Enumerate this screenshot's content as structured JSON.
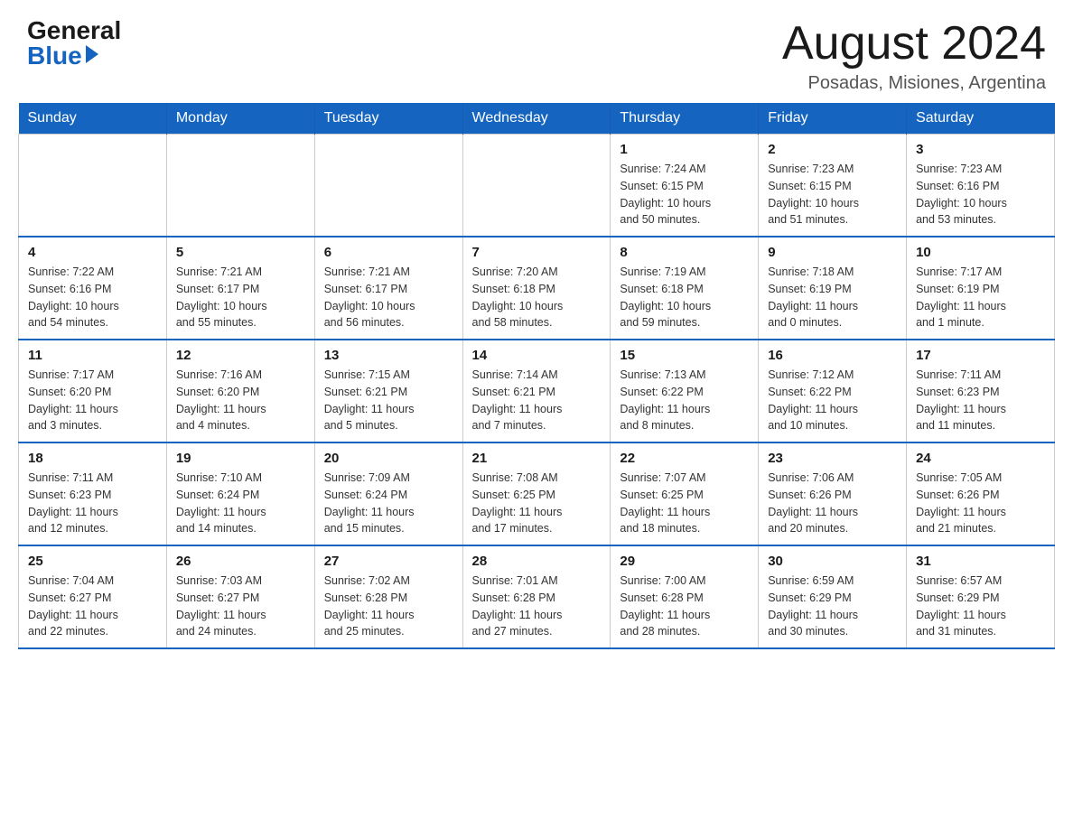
{
  "header": {
    "logo_general": "General",
    "logo_blue": "Blue",
    "month_title": "August 2024",
    "location": "Posadas, Misiones, Argentina"
  },
  "days_of_week": [
    "Sunday",
    "Monday",
    "Tuesday",
    "Wednesday",
    "Thursday",
    "Friday",
    "Saturday"
  ],
  "weeks": [
    [
      {
        "day": "",
        "info": ""
      },
      {
        "day": "",
        "info": ""
      },
      {
        "day": "",
        "info": ""
      },
      {
        "day": "",
        "info": ""
      },
      {
        "day": "1",
        "info": "Sunrise: 7:24 AM\nSunset: 6:15 PM\nDaylight: 10 hours\nand 50 minutes."
      },
      {
        "day": "2",
        "info": "Sunrise: 7:23 AM\nSunset: 6:15 PM\nDaylight: 10 hours\nand 51 minutes."
      },
      {
        "day": "3",
        "info": "Sunrise: 7:23 AM\nSunset: 6:16 PM\nDaylight: 10 hours\nand 53 minutes."
      }
    ],
    [
      {
        "day": "4",
        "info": "Sunrise: 7:22 AM\nSunset: 6:16 PM\nDaylight: 10 hours\nand 54 minutes."
      },
      {
        "day": "5",
        "info": "Sunrise: 7:21 AM\nSunset: 6:17 PM\nDaylight: 10 hours\nand 55 minutes."
      },
      {
        "day": "6",
        "info": "Sunrise: 7:21 AM\nSunset: 6:17 PM\nDaylight: 10 hours\nand 56 minutes."
      },
      {
        "day": "7",
        "info": "Sunrise: 7:20 AM\nSunset: 6:18 PM\nDaylight: 10 hours\nand 58 minutes."
      },
      {
        "day": "8",
        "info": "Sunrise: 7:19 AM\nSunset: 6:18 PM\nDaylight: 10 hours\nand 59 minutes."
      },
      {
        "day": "9",
        "info": "Sunrise: 7:18 AM\nSunset: 6:19 PM\nDaylight: 11 hours\nand 0 minutes."
      },
      {
        "day": "10",
        "info": "Sunrise: 7:17 AM\nSunset: 6:19 PM\nDaylight: 11 hours\nand 1 minute."
      }
    ],
    [
      {
        "day": "11",
        "info": "Sunrise: 7:17 AM\nSunset: 6:20 PM\nDaylight: 11 hours\nand 3 minutes."
      },
      {
        "day": "12",
        "info": "Sunrise: 7:16 AM\nSunset: 6:20 PM\nDaylight: 11 hours\nand 4 minutes."
      },
      {
        "day": "13",
        "info": "Sunrise: 7:15 AM\nSunset: 6:21 PM\nDaylight: 11 hours\nand 5 minutes."
      },
      {
        "day": "14",
        "info": "Sunrise: 7:14 AM\nSunset: 6:21 PM\nDaylight: 11 hours\nand 7 minutes."
      },
      {
        "day": "15",
        "info": "Sunrise: 7:13 AM\nSunset: 6:22 PM\nDaylight: 11 hours\nand 8 minutes."
      },
      {
        "day": "16",
        "info": "Sunrise: 7:12 AM\nSunset: 6:22 PM\nDaylight: 11 hours\nand 10 minutes."
      },
      {
        "day": "17",
        "info": "Sunrise: 7:11 AM\nSunset: 6:23 PM\nDaylight: 11 hours\nand 11 minutes."
      }
    ],
    [
      {
        "day": "18",
        "info": "Sunrise: 7:11 AM\nSunset: 6:23 PM\nDaylight: 11 hours\nand 12 minutes."
      },
      {
        "day": "19",
        "info": "Sunrise: 7:10 AM\nSunset: 6:24 PM\nDaylight: 11 hours\nand 14 minutes."
      },
      {
        "day": "20",
        "info": "Sunrise: 7:09 AM\nSunset: 6:24 PM\nDaylight: 11 hours\nand 15 minutes."
      },
      {
        "day": "21",
        "info": "Sunrise: 7:08 AM\nSunset: 6:25 PM\nDaylight: 11 hours\nand 17 minutes."
      },
      {
        "day": "22",
        "info": "Sunrise: 7:07 AM\nSunset: 6:25 PM\nDaylight: 11 hours\nand 18 minutes."
      },
      {
        "day": "23",
        "info": "Sunrise: 7:06 AM\nSunset: 6:26 PM\nDaylight: 11 hours\nand 20 minutes."
      },
      {
        "day": "24",
        "info": "Sunrise: 7:05 AM\nSunset: 6:26 PM\nDaylight: 11 hours\nand 21 minutes."
      }
    ],
    [
      {
        "day": "25",
        "info": "Sunrise: 7:04 AM\nSunset: 6:27 PM\nDaylight: 11 hours\nand 22 minutes."
      },
      {
        "day": "26",
        "info": "Sunrise: 7:03 AM\nSunset: 6:27 PM\nDaylight: 11 hours\nand 24 minutes."
      },
      {
        "day": "27",
        "info": "Sunrise: 7:02 AM\nSunset: 6:28 PM\nDaylight: 11 hours\nand 25 minutes."
      },
      {
        "day": "28",
        "info": "Sunrise: 7:01 AM\nSunset: 6:28 PM\nDaylight: 11 hours\nand 27 minutes."
      },
      {
        "day": "29",
        "info": "Sunrise: 7:00 AM\nSunset: 6:28 PM\nDaylight: 11 hours\nand 28 minutes."
      },
      {
        "day": "30",
        "info": "Sunrise: 6:59 AM\nSunset: 6:29 PM\nDaylight: 11 hours\nand 30 minutes."
      },
      {
        "day": "31",
        "info": "Sunrise: 6:57 AM\nSunset: 6:29 PM\nDaylight: 11 hours\nand 31 minutes."
      }
    ]
  ]
}
